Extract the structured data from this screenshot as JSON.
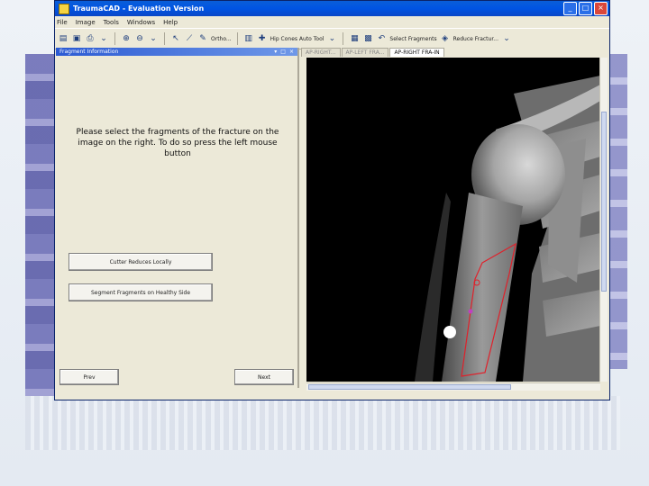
{
  "window": {
    "title": "TraumaCAD - Evaluation Version",
    "controls": [
      "_",
      "□",
      "×"
    ]
  },
  "menu": [
    "File",
    "Image",
    "Tools",
    "Windows",
    "Help"
  ],
  "toolbar": {
    "measure_label": "Ortho...",
    "auto_tool_label": "Hip Cones Auto Tool",
    "fragments_label": "Select Fragments",
    "reduce_label": "Reduce Fractur..."
  },
  "panel": {
    "title": "Fragment Information",
    "instruction": "Please select the fragments of the fracture on the image on the right. To do so press the left mouse button",
    "reduce_button": "Cutter Reduces Locally",
    "segment_button": "Segment Fragments on Healthy Side",
    "prev_button": "Prev",
    "next_button": "Next"
  },
  "viewer": {
    "tabs": [
      "AP-RIGHT...",
      "AP-LEFT FRA...",
      "AP-RIGHT FRA-IN"
    ],
    "active_tab": 2
  },
  "colors": {
    "titlebar": "#0054e3",
    "selection": "#e0202a",
    "panel": "#ece9d8"
  }
}
